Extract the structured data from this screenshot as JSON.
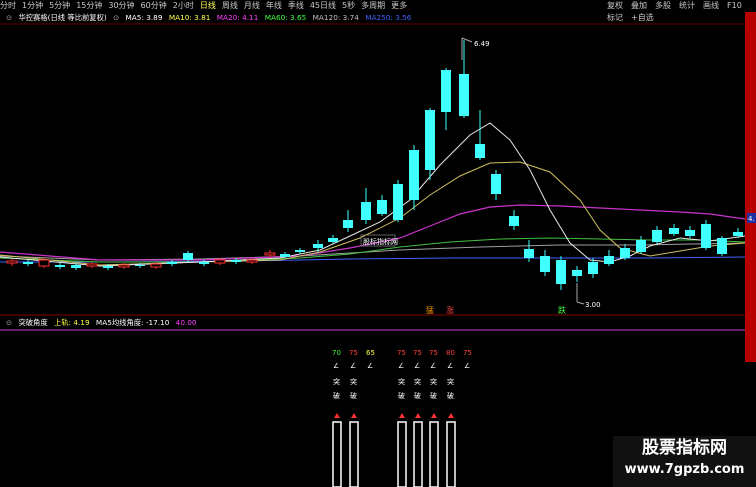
{
  "toolbar": {
    "timeframes": [
      "分时",
      "1分钟",
      "5分钟",
      "15分钟",
      "30分钟",
      "60分钟",
      "2小时",
      "日线",
      "周线",
      "月线",
      "年线",
      "季线",
      "45日线",
      "5秒",
      "多周期",
      "更多"
    ],
    "active": "日线",
    "right_buttons": [
      "复权",
      "叠加",
      "多股",
      "统计",
      "画线",
      "F10",
      "标记"
    ],
    "right_extra": "+自选"
  },
  "main_info": {
    "title": "华控赛格(日线 等比前复权)",
    "ma5": "MA5: 3.89",
    "ma10": "MA10: 3.81",
    "ma20": "MA20: 4.11",
    "ma60": "MA60: 3.65",
    "ma120": "MA120: 3.74",
    "ma250": "MA250: 3.56",
    "colors": {
      "ma5": "#ffffff",
      "ma10": "#ffff40",
      "ma20": "#ff40ff",
      "ma60": "#40ff40",
      "ma120": "#c0c0c0",
      "ma250": "#4060ff"
    }
  },
  "annotations": {
    "high": "6.49",
    "low": "3.00",
    "chart_label": "股标指标网",
    "surge": "猛",
    "rise": "涨",
    "fall": "跌",
    "price_tag": "4."
  },
  "lower_info": {
    "title": "突破角度",
    "upper": "上轨: 4.19",
    "ma5_angle": "MA5均线角度: -17.10",
    "value": "40.00"
  },
  "signals": [
    {
      "angle": "70",
      "angle_color": "#40ff40",
      "arrow": "∠",
      "t1": "突",
      "t2": "破"
    },
    {
      "angle": "75",
      "angle_color": "#ff4040",
      "arrow": "∠",
      "t1": "突",
      "t2": "破"
    },
    {
      "angle": "65",
      "angle_color": "#ffff40",
      "arrow": "∠",
      "t1": "",
      "t2": ""
    },
    {
      "angle": "75",
      "angle_color": "#ff4040",
      "arrow": "∠",
      "t1": "突",
      "t2": "破"
    },
    {
      "angle": "75",
      "angle_color": "#ff4040",
      "arrow": "∠",
      "t1": "突",
      "t2": "破"
    },
    {
      "angle": "75",
      "angle_color": "#ff4040",
      "arrow": "∠",
      "t1": "突",
      "t2": "破"
    },
    {
      "angle": "80",
      "angle_color": "#ff4040",
      "arrow": "∠",
      "t1": "突",
      "t2": "破"
    },
    {
      "angle": "75",
      "angle_color": "#ff4040",
      "arrow": "∠",
      "t1": "",
      "t2": ""
    }
  ],
  "watermark": {
    "title": "股票指标网",
    "url": "www.7gpzb.com"
  },
  "colors": {
    "up": "#ff3030",
    "down": "#40ffff",
    "bg": "#000000",
    "magenta_line": "#cc33cc"
  }
}
